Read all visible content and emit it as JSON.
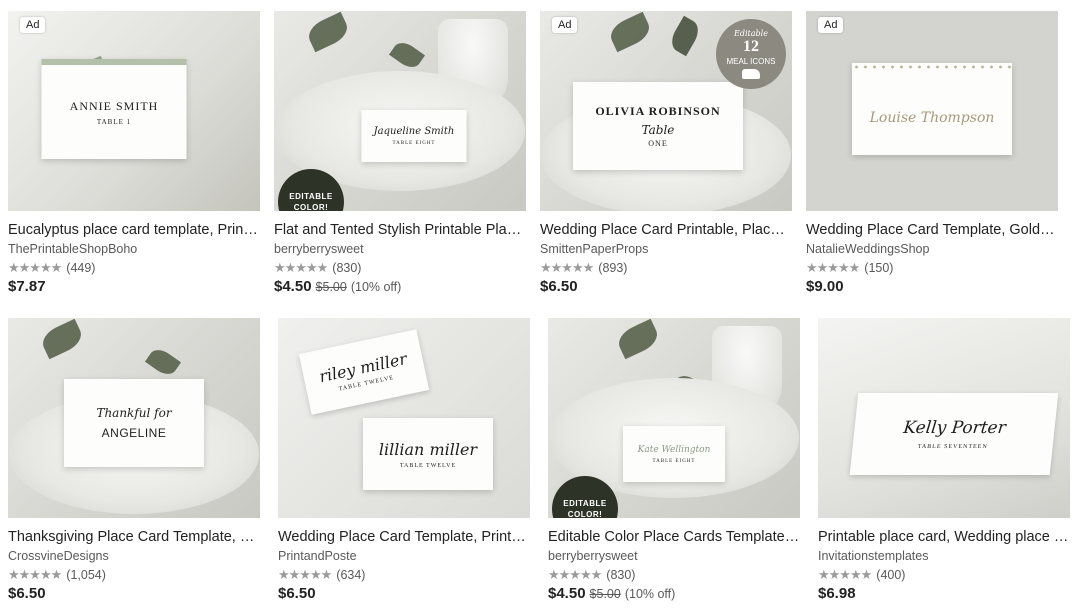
{
  "listings": [
    {
      "ad": "Ad",
      "title": "Eucalyptus place card template, Printable place card, Wedding Place Card",
      "shop": "ThePrintableShopBoho",
      "stars": "★★★★★",
      "reviews": "(449)",
      "price": "$7.87",
      "card_name": "ANNIE SMITH",
      "card_sub": "TABLE 1"
    },
    {
      "title": "Flat and Tented Stylish Printable Place Cards",
      "shop": "berryberrysweet",
      "stars": "★★★★★",
      "reviews": "(830)",
      "price": "$4.50",
      "orig_price": "$5.00",
      "discount": "(10% off)",
      "badge_line1": "EDITABLE",
      "badge_line2": "COLOR!",
      "card_name": "Jaqueline Smith",
      "card_sub": "TABLE EIGHT"
    },
    {
      "ad": "Ad",
      "title": "Wedding Place Card Printable, Place Card Template",
      "shop": "SmittenPaperProps",
      "stars": "★★★★★",
      "reviews": "(893)",
      "price": "$6.50",
      "card_name": "OLIVIA ROBINSON",
      "card_script": "Table",
      "card_sub": "ONE",
      "meal_top": "Editable",
      "meal_num": "12",
      "meal_bottom": "MEAL ICONS"
    },
    {
      "ad": "Ad",
      "title": "Wedding Place Card Template, Gold Confetti Place Card",
      "shop": "NatalieWeddingsShop",
      "stars": "★★★★★",
      "reviews": "(150)",
      "price": "$9.00",
      "card_name": "Louise Thompson"
    },
    {
      "title": "Thanksgiving Place Card Template, Editable Place Cards",
      "shop": "CrossvineDesigns",
      "stars": "★★★★★",
      "reviews": "(1,054)",
      "price": "$6.50",
      "card_script": "Thankful for",
      "card_name": "ANGELINE"
    },
    {
      "title": "Wedding Place Card Template, Printable Place Cards",
      "shop": "PrintandPoste",
      "stars": "★★★★★",
      "reviews": "(634)",
      "price": "$6.50",
      "card_name": "riley miller",
      "card_sub": "TABLE TWELVE",
      "card2_name": "lillian miller",
      "card2_sub": "TABLE TWELVE"
    },
    {
      "title": "Editable Color Place Cards Template, Printable",
      "shop": "berryberrysweet",
      "stars": "★★★★★",
      "reviews": "(830)",
      "price": "$4.50",
      "orig_price": "$5.00",
      "discount": "(10% off)",
      "badge_line1": "EDITABLE",
      "badge_line2": "COLOR!",
      "card_name": "Kate Wellington",
      "card_sub": "TABLE EIGHT"
    },
    {
      "title": "Printable place card, Wedding place card template",
      "shop": "Invitationstemplates",
      "stars": "★★★★★",
      "reviews": "(400)",
      "price": "$6.98",
      "card_name": "Kelly Porter",
      "card_sub": "TABLE SEVENTEEN"
    }
  ]
}
